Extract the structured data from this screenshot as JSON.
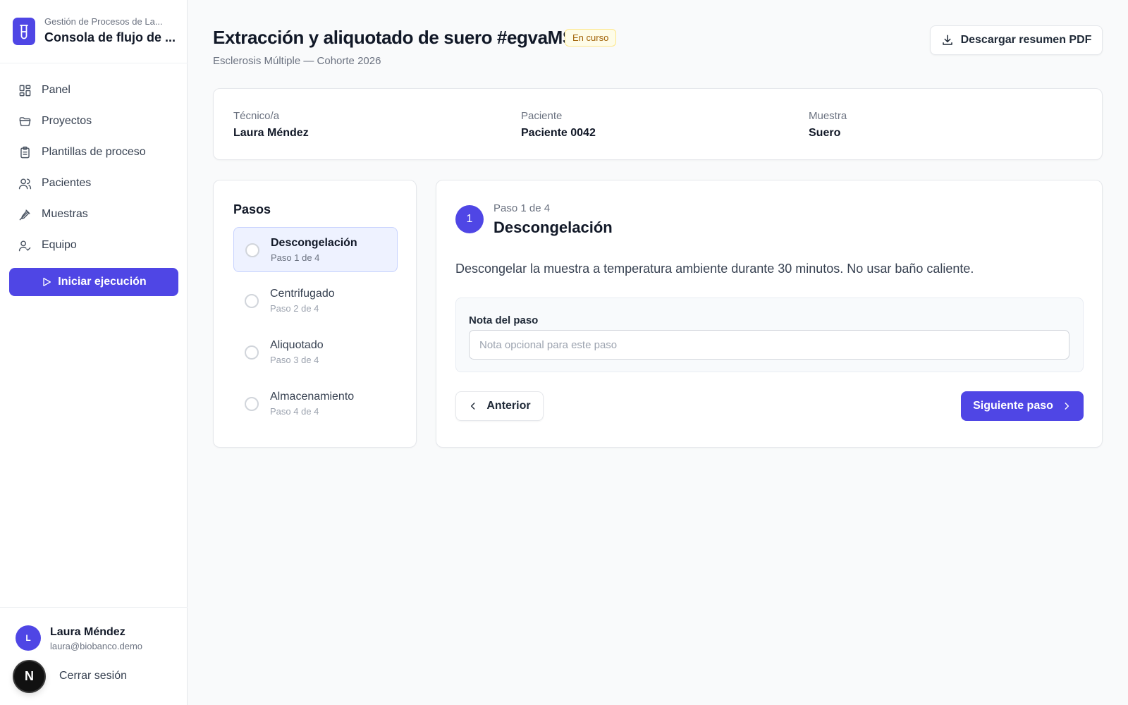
{
  "brand": {
    "subtitle": "Gestión de Procesos de La...",
    "title": "Consola de flujo de ...",
    "logo_icon": "test-tube-icon",
    "accent_color": "#4f46e5"
  },
  "nav": {
    "items": [
      {
        "label": "Panel",
        "icon": "dashboard-icon"
      },
      {
        "label": "Proyectos",
        "icon": "folder-icon"
      },
      {
        "label": "Plantillas de proceso",
        "icon": "clipboard-icon"
      },
      {
        "label": "Pacientes",
        "icon": "users-icon"
      },
      {
        "label": "Muestras",
        "icon": "pipette-icon"
      },
      {
        "label": "Equipo",
        "icon": "user-check-icon"
      }
    ],
    "primary_button": "Iniciar ejecución"
  },
  "user": {
    "initial": "L",
    "name": "Laura Méndez",
    "email": "laura@biobanco.demo",
    "badge": "N",
    "logout": "Cerrar sesión"
  },
  "header": {
    "title": "Extracción y aliquotado de suero #egvaMS",
    "status": "En curso",
    "subtitle": "Esclerosis Múltiple — Cohorte 2026",
    "download_button": "Descargar resumen PDF"
  },
  "info": [
    {
      "label": "Técnico/a",
      "value": "Laura Méndez"
    },
    {
      "label": "Paciente",
      "value": "Paciente 0042"
    },
    {
      "label": "Muestra",
      "value": "Suero"
    }
  ],
  "steps": {
    "title": "Pasos",
    "items": [
      {
        "name": "Descongelación",
        "sub": "Paso 1 de 4",
        "active": true
      },
      {
        "name": "Centrifugado",
        "sub": "Paso 2 de 4",
        "active": false
      },
      {
        "name": "Aliquotado",
        "sub": "Paso 3 de 4",
        "active": false
      },
      {
        "name": "Almacenamiento",
        "sub": "Paso 4 de 4",
        "active": false
      }
    ]
  },
  "current_step": {
    "number": "1",
    "of": "Paso 1 de 4",
    "title": "Descongelación",
    "description": "Descongelar la muestra a temperatura ambiente durante 30 minutos. No usar baño caliente.",
    "note_label": "Nota del paso",
    "note_value": "",
    "note_placeholder": "Nota opcional para este paso",
    "prev_button": "Anterior",
    "next_button": "Siguiente paso"
  }
}
